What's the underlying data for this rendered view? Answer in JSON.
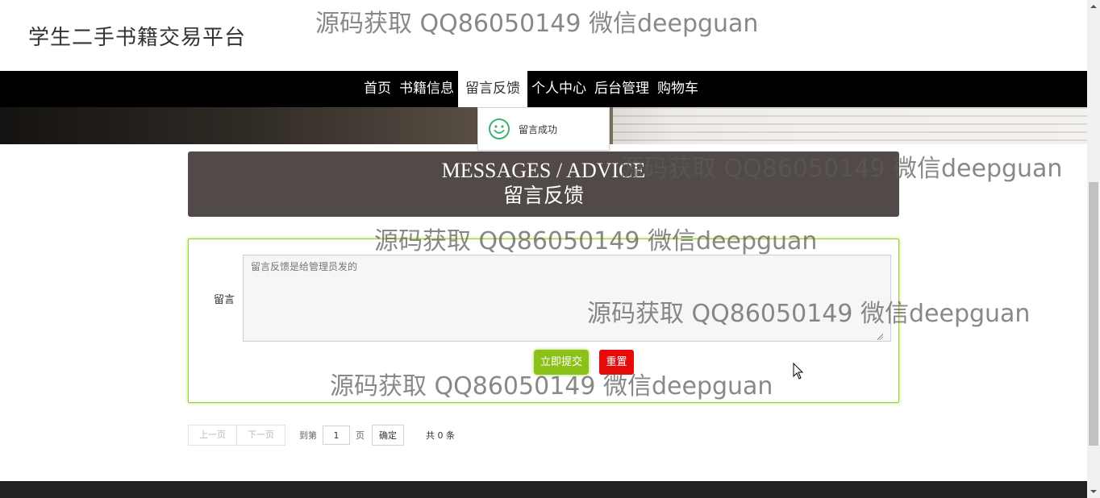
{
  "header": {
    "site_title": "学生二手书籍交易平台"
  },
  "nav": {
    "items": [
      {
        "label": "首页"
      },
      {
        "label": "书籍信息"
      },
      {
        "label": "留言反馈"
      },
      {
        "label": "个人中心"
      },
      {
        "label": "后台管理"
      },
      {
        "label": "购物车"
      }
    ],
    "active_index": 2
  },
  "toast": {
    "icon": "smile-icon",
    "message": "留言成功"
  },
  "section": {
    "title_en": "MESSAGES / ADVICE",
    "title_cn": "留言反馈"
  },
  "form": {
    "label": "留言",
    "textarea_placeholder": "留言反馈是给管理员发的",
    "submit_label": "立即提交",
    "reset_label": "重置"
  },
  "pagination": {
    "prev": "上一页",
    "next": "下一页",
    "goto_prefix": "到第",
    "page_value": "1",
    "goto_suffix": "页",
    "confirm": "确定",
    "total": "共 0 条"
  },
  "watermark": "源码获取 QQ86050149 微信deepguan",
  "colors": {
    "accent_green": "#8cc11b",
    "reset_red": "#e60b0b",
    "title_bar": "#514a48",
    "nav_bg": "#000000"
  }
}
